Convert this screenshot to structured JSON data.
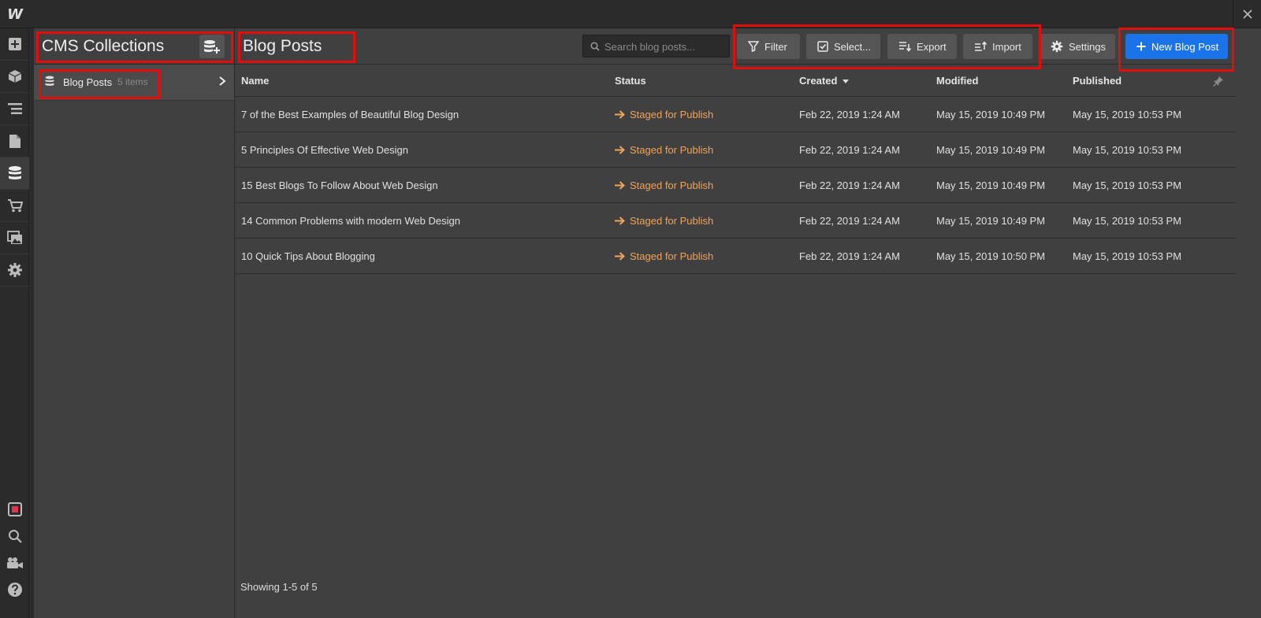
{
  "app": {
    "logo": "W"
  },
  "left_sidebar": {
    "items": [
      {
        "icon": "plus-icon",
        "label": "Add"
      },
      {
        "icon": "box-icon",
        "label": "Symbols"
      },
      {
        "icon": "navigator-icon",
        "label": "Navigator"
      },
      {
        "icon": "page-icon",
        "label": "Pages"
      },
      {
        "icon": "database-icon",
        "label": "CMS"
      },
      {
        "icon": "cart-icon",
        "label": "Ecommerce"
      },
      {
        "icon": "images-icon",
        "label": "Assets"
      },
      {
        "icon": "gear-icon",
        "label": "Settings"
      }
    ],
    "bottom": [
      {
        "icon": "stop-icon"
      },
      {
        "icon": "search-icon"
      },
      {
        "icon": "video-icon"
      },
      {
        "icon": "help-icon"
      }
    ]
  },
  "collections": {
    "title": "CMS Collections",
    "items": [
      {
        "name": "Blog Posts",
        "count": "5 items"
      }
    ]
  },
  "main": {
    "title": "Blog Posts",
    "search_placeholder": "Search blog posts...",
    "buttons": {
      "filter": "Filter",
      "select": "Select...",
      "export": "Export",
      "import": "Import",
      "settings": "Settings",
      "new_post": "New Blog Post"
    },
    "columns": {
      "name": "Name",
      "status": "Status",
      "created": "Created",
      "modified": "Modified",
      "published": "Published"
    },
    "rows": [
      {
        "name": "7 of the Best Examples of Beautiful Blog Design",
        "status": "Staged for Publish",
        "created": "Feb 22, 2019 1:24 AM",
        "modified": "May 15, 2019 10:49 PM",
        "published": "May 15, 2019 10:53 PM"
      },
      {
        "name": "5 Principles Of Effective Web Design",
        "status": "Staged for Publish",
        "created": "Feb 22, 2019 1:24 AM",
        "modified": "May 15, 2019 10:49 PM",
        "published": "May 15, 2019 10:53 PM"
      },
      {
        "name": "15 Best Blogs To Follow About Web Design",
        "status": "Staged for Publish",
        "created": "Feb 22, 2019 1:24 AM",
        "modified": "May 15, 2019 10:49 PM",
        "published": "May 15, 2019 10:53 PM"
      },
      {
        "name": "14 Common Problems with modern Web Design",
        "status": "Staged for Publish",
        "created": "Feb 22, 2019 1:24 AM",
        "modified": "May 15, 2019 10:49 PM",
        "published": "May 15, 2019 10:53 PM"
      },
      {
        "name": "10 Quick Tips About Blogging",
        "status": "Staged for Publish",
        "created": "Feb 22, 2019 1:24 AM",
        "modified": "May 15, 2019 10:50 PM",
        "published": "May 15, 2019 10:53 PM"
      }
    ],
    "footer": "Showing 1-5 of 5"
  },
  "colors": {
    "accent": "#1a73e8",
    "status": "#f0a35a",
    "highlight": "#e20e0e"
  }
}
